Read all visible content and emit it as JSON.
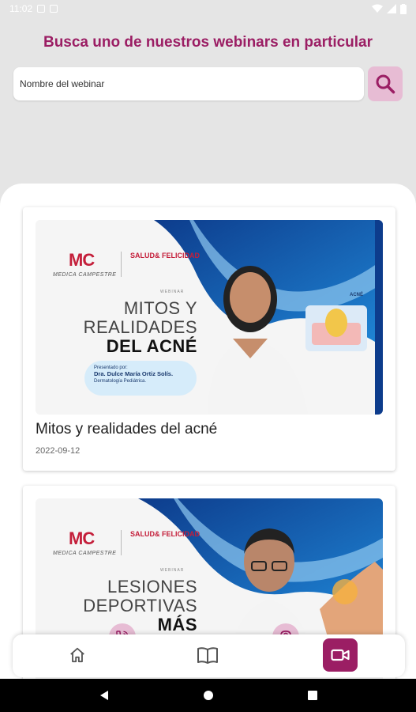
{
  "status_bar": {
    "time": "11:02"
  },
  "header": {
    "title": "Busca uno de nuestros webinars en particular"
  },
  "search": {
    "placeholder": "Nombre del webinar",
    "value": ""
  },
  "webinars": [
    {
      "title": "Mitos y realidades del acné",
      "date": "2022-09-12",
      "banner": {
        "brand": "MC",
        "brand_sub": "MEDICA CAMPESTRE",
        "partner": "SALUD& FELICIDAD",
        "tag": "WEBINAR",
        "headline_light_1": "MITOS Y",
        "headline_light_2": "REALIDADES",
        "headline_strong": "DEL ACNÉ",
        "presenter_intro": "Presentado por:",
        "presenter_name": "Dra. Dulce María Ortiz Solís.",
        "presenter_role": "Dermatología Pediátrica.",
        "topic_label": "ACNÉ"
      }
    },
    {
      "title": "",
      "date": "",
      "banner": {
        "brand": "MC",
        "brand_sub": "MEDICA CAMPESTRE",
        "partner": "SALUD& FELICIDAD",
        "tag": "WEBINAR",
        "headline_light_1": "LESIONES",
        "headline_light_2": "DEPORTIVAS",
        "headline_strong": "MÁS FRECUENTES"
      }
    }
  ],
  "bottom_nav": {
    "items": [
      "home-icon",
      "book-icon",
      "phone-icon",
      "location-icon",
      "video-icon"
    ],
    "active": "video-icon"
  },
  "colors": {
    "accent": "#9b1e64",
    "accent_light": "#e7bcd4",
    "background": "#e5e5e5"
  }
}
